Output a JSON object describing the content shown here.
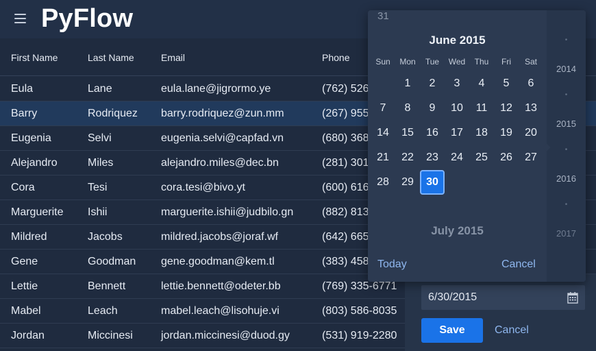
{
  "app": {
    "title": "PyFlow"
  },
  "grid": {
    "columns": [
      "First Name",
      "Last Name",
      "Email",
      "Phone"
    ],
    "rows": [
      [
        "Eula",
        "Lane",
        "eula.lane@jigrormo.ye",
        "(762) 526"
      ],
      [
        "Barry",
        "Rodriquez",
        "barry.rodriquez@zun.mm",
        "(267) 955"
      ],
      [
        "Eugenia",
        "Selvi",
        "eugenia.selvi@capfad.vn",
        "(680) 368"
      ],
      [
        "Alejandro",
        "Miles",
        "alejandro.miles@dec.bn",
        "(281) 301"
      ],
      [
        "Cora",
        "Tesi",
        "cora.tesi@bivo.yt",
        "(600) 616"
      ],
      [
        "Marguerite",
        "Ishii",
        "marguerite.ishii@judbilo.gn",
        "(882) 813"
      ],
      [
        "Mildred",
        "Jacobs",
        "mildred.jacobs@joraf.wf",
        "(642) 665"
      ],
      [
        "Gene",
        "Goodman",
        "gene.goodman@kem.tl",
        "(383) 458"
      ],
      [
        "Lettie",
        "Bennett",
        "lettie.bennett@odeter.bb",
        "(769) 335-6771"
      ],
      [
        "Mabel",
        "Leach",
        "mabel.leach@lisohuje.vi",
        "(803) 586-8035"
      ],
      [
        "Jordan",
        "Miccinesi",
        "jordan.miccinesi@duod.gy",
        "(531) 919-2280"
      ]
    ]
  },
  "form": {
    "date_value": "6/30/2015",
    "save_label": "Save",
    "cancel_label": "Cancel"
  },
  "picker": {
    "prev_tail": "31",
    "month_label": "June 2015",
    "weekdays": [
      "Sun",
      "Mon",
      "Tue",
      "Wed",
      "Thu",
      "Fri",
      "Sat"
    ],
    "days": [
      [
        "",
        "1",
        "2",
        "3",
        "4",
        "5",
        "6"
      ],
      [
        "7",
        "8",
        "9",
        "10",
        "11",
        "12",
        "13"
      ],
      [
        "14",
        "15",
        "16",
        "17",
        "18",
        "19",
        "20"
      ],
      [
        "21",
        "22",
        "23",
        "24",
        "25",
        "26",
        "27"
      ],
      [
        "28",
        "29",
        "30",
        "",
        "",
        "",
        ""
      ]
    ],
    "selected_day": "30",
    "next_month_label": "July 2015",
    "today_label": "Today",
    "cancel_label": "Cancel",
    "years": [
      "2014",
      "2015",
      "2016",
      "2017"
    ]
  },
  "colors": {
    "accent": "#1a73e8",
    "link": "#8fb7ef",
    "background": "#1f2b3f"
  }
}
